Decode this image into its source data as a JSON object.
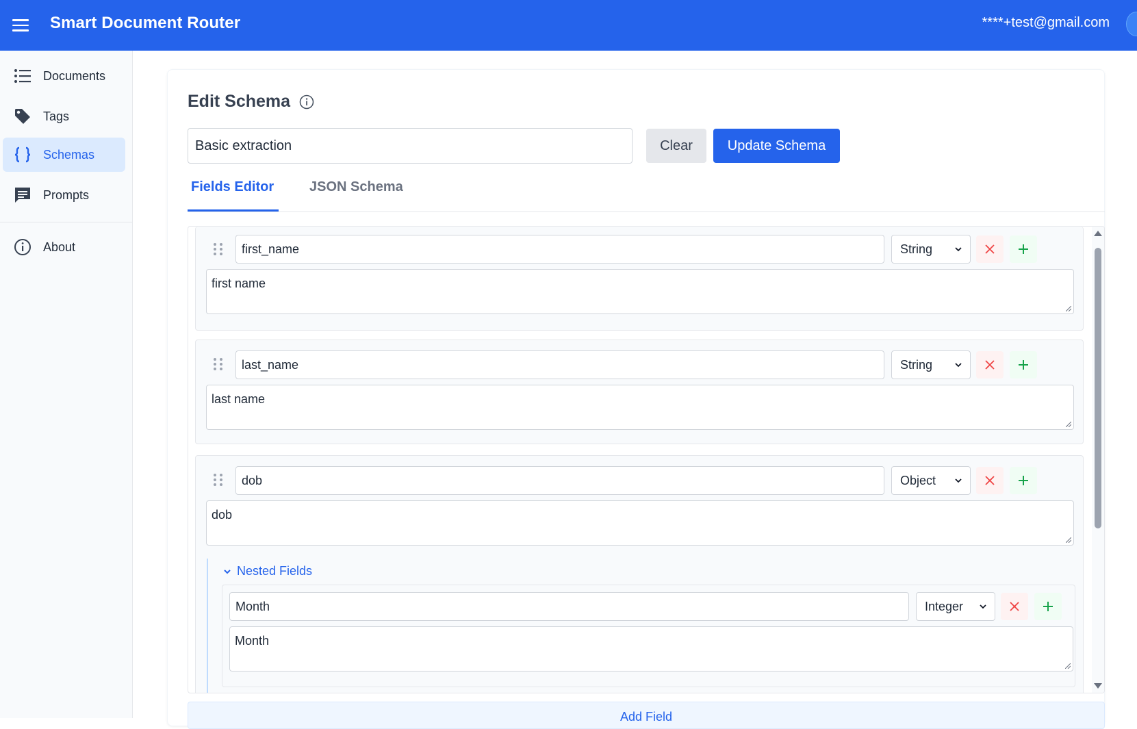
{
  "header": {
    "app_title": "Smart Document Router",
    "user_email": "****+test@gmail.com",
    "brand_color": "#2563eb"
  },
  "sidebar": {
    "items": [
      {
        "label": "Documents",
        "icon": "list-icon",
        "active": false
      },
      {
        "label": "Tags",
        "icon": "tag-icon",
        "active": false
      },
      {
        "label": "Schemas",
        "icon": "braces-icon",
        "active": true
      },
      {
        "label": "Prompts",
        "icon": "message-icon",
        "active": false
      },
      {
        "label": "About",
        "icon": "info-icon",
        "active": false
      }
    ]
  },
  "editor": {
    "title": "Edit Schema",
    "schema_name": "Basic extraction",
    "clear_label": "Clear",
    "update_label": "Update Schema",
    "tabs": [
      {
        "label": "Fields Editor",
        "active": true
      },
      {
        "label": "JSON Schema",
        "active": false
      }
    ],
    "fields": [
      {
        "name": "first_name",
        "type": "String",
        "description": "first name"
      },
      {
        "name": "last_name",
        "type": "String",
        "description": "last name"
      },
      {
        "name": "dob",
        "type": "Object",
        "description": "dob",
        "nested_label": "Nested Fields",
        "nested": [
          {
            "name": "Month",
            "type": "Integer",
            "description": "Month"
          }
        ]
      }
    ],
    "add_field_label": "Add Field"
  }
}
